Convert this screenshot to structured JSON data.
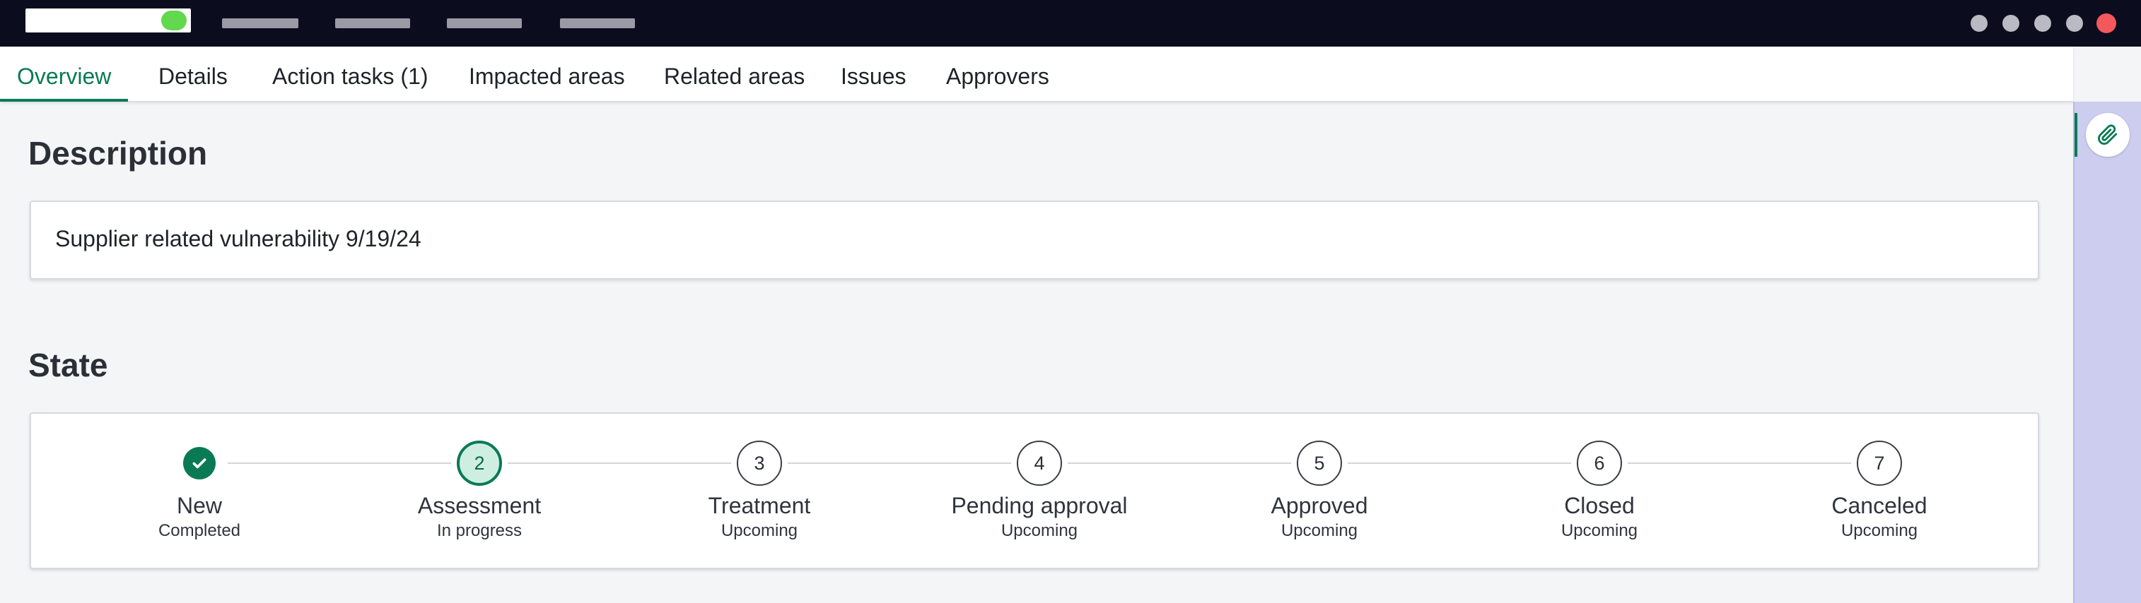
{
  "tabs": [
    {
      "label": "Overview",
      "active": true
    },
    {
      "label": "Details",
      "active": false
    },
    {
      "label": "Action tasks (1)",
      "active": false
    },
    {
      "label": "Impacted areas",
      "active": false
    },
    {
      "label": "Related areas",
      "active": false
    },
    {
      "label": "Issues",
      "active": false
    },
    {
      "label": "Approvers",
      "active": false
    }
  ],
  "description": {
    "heading": "Description",
    "text": "Supplier related vulnerability 9/19/24"
  },
  "state": {
    "heading": "State",
    "steps": [
      {
        "number": "",
        "name": "New",
        "status": "Completed",
        "state": "completed"
      },
      {
        "number": "2",
        "name": "Assessment",
        "status": "In progress",
        "state": "current"
      },
      {
        "number": "3",
        "name": "Treatment",
        "status": "Upcoming",
        "state": "upcoming"
      },
      {
        "number": "4",
        "name": "Pending approval",
        "status": "Upcoming",
        "state": "upcoming"
      },
      {
        "number": "5",
        "name": "Approved",
        "status": "Upcoming",
        "state": "upcoming"
      },
      {
        "number": "6",
        "name": "Closed",
        "status": "Upcoming",
        "state": "upcoming"
      },
      {
        "number": "7",
        "name": "Canceled",
        "status": "Upcoming",
        "state": "upcoming"
      }
    ]
  },
  "icons": {
    "attachment": "paperclip-icon",
    "completed": "checkmark-icon"
  },
  "colors": {
    "accent": "#0a7a55",
    "topbar": "#0c0c1f",
    "side_panel": "#cdcdf0",
    "current_step_fill": "#cfeee2"
  }
}
